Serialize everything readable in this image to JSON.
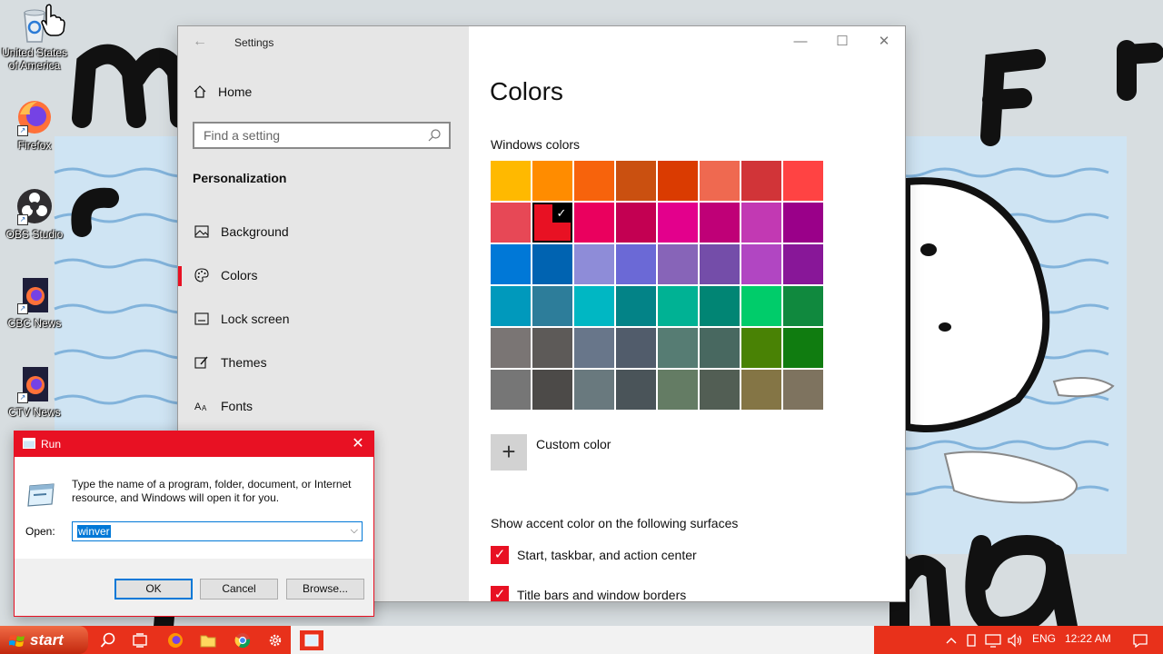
{
  "desktop": {
    "icons": [
      {
        "label": "United States of America",
        "icon": "recycle-bin-icon"
      },
      {
        "label": "Firefox",
        "icon": "firefox-icon"
      },
      {
        "label": "OBS Studio",
        "icon": "obs-icon"
      },
      {
        "label": "CBC News",
        "icon": "firefox-document-icon"
      },
      {
        "label": "CTV News",
        "icon": "firefox-document-icon"
      }
    ]
  },
  "settings": {
    "window_title": "Settings",
    "nav": {
      "home_label": "Home",
      "search_placeholder": "Find a setting",
      "section_title": "Personalization",
      "items": [
        {
          "label": "Background",
          "icon": "picture-icon"
        },
        {
          "label": "Colors",
          "icon": "palette-icon",
          "active": true
        },
        {
          "label": "Lock screen",
          "icon": "lock-screen-icon"
        },
        {
          "label": "Themes",
          "icon": "themes-icon"
        },
        {
          "label": "Fonts",
          "icon": "fonts-icon"
        }
      ]
    },
    "main": {
      "title": "Colors",
      "windows_colors_label": "Windows colors",
      "swatches": [
        "#ffb900",
        "#ff8c00",
        "#f7630c",
        "#ca5010",
        "#da3b01",
        "#ef6950",
        "#d13438",
        "#ff4343",
        "#e74856",
        "#e81123",
        "#ea005e",
        "#c30052",
        "#e3008c",
        "#bf0077",
        "#c239b3",
        "#9a0089",
        "#0078d7",
        "#0063b1",
        "#8e8cd8",
        "#6b69d6",
        "#8764b8",
        "#744da9",
        "#b146c2",
        "#881798",
        "#0099bc",
        "#2d7d9a",
        "#00b7c3",
        "#038387",
        "#00b294",
        "#018574",
        "#00cc6a",
        "#10893e",
        "#7a7574",
        "#5d5a58",
        "#68768a",
        "#515c6b",
        "#567c73",
        "#486860",
        "#498205",
        "#107c10",
        "#767676",
        "#4c4a48",
        "#69797e",
        "#4a5459",
        "#647c64",
        "#525e54",
        "#847545",
        "#7e735f"
      ],
      "selected_swatch_index": 9,
      "custom_color_label": "Custom color",
      "surfaces_label": "Show accent color on the following surfaces",
      "checkboxes": [
        {
          "label": "Start, taskbar, and action center",
          "checked": true
        },
        {
          "label": "Title bars and window borders",
          "checked": true
        }
      ]
    }
  },
  "run_dialog": {
    "title": "Run",
    "description": "Type the name of a program, folder, document, or Internet resource, and Windows will open it for you.",
    "open_label": "Open:",
    "open_value": "winver",
    "buttons": {
      "ok": "OK",
      "cancel": "Cancel",
      "browse": "Browse..."
    }
  },
  "taskbar": {
    "start_label": "start",
    "language": "ENG",
    "clock": "12:22 AM"
  },
  "colors": {
    "accent": "#e81123",
    "taskbar": "#e8311b",
    "selection": "#0078d7"
  }
}
